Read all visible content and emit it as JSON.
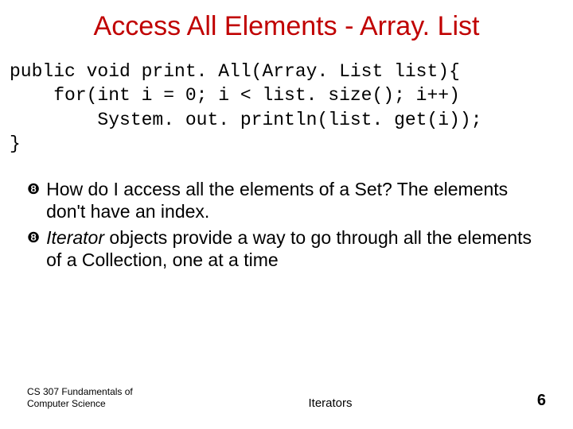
{
  "title": "Access All Elements - Array. List",
  "code": {
    "line1": "public void print. All(Array. List list){",
    "line2": "    for(int i = 0; i < list. size(); i++)",
    "line3": "        System. out. println(list. get(i));",
    "line4": "}"
  },
  "bullets": [
    {
      "pre": "How do I access all the elements of a Set? The elements don't have an index."
    },
    {
      "italic": "Iterator",
      "post": " objects provide a way to go through all the elements of a Collection, one at a time"
    }
  ],
  "footer": {
    "left": "CS 307 Fundamentals of Computer Science",
    "center": "Iterators",
    "page": "6"
  }
}
